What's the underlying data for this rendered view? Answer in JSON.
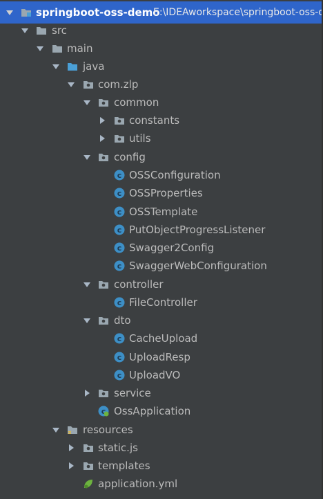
{
  "project_tree": {
    "root": {
      "label": "springboot-oss-demo",
      "path": "E:\\IDEAworkspace\\springboot-oss-demo"
    },
    "nodes": [
      {
        "label": "src"
      },
      {
        "label": "main"
      },
      {
        "label": "java"
      },
      {
        "label": "com.zlp"
      },
      {
        "label": "common"
      },
      {
        "label": "constants"
      },
      {
        "label": "utils"
      },
      {
        "label": "config"
      },
      {
        "label": "OSSConfiguration"
      },
      {
        "label": "OSSProperties"
      },
      {
        "label": "OSSTemplate"
      },
      {
        "label": "PutObjectProgressListener"
      },
      {
        "label": "Swagger2Config"
      },
      {
        "label": "SwaggerWebConfiguration"
      },
      {
        "label": "controller"
      },
      {
        "label": "FileController"
      },
      {
        "label": "dto"
      },
      {
        "label": "CacheUpload"
      },
      {
        "label": "UploadResp"
      },
      {
        "label": "UploadVO"
      },
      {
        "label": "service"
      },
      {
        "label": "OssApplication"
      },
      {
        "label": "resources"
      },
      {
        "label": "static.js"
      },
      {
        "label": "templates"
      },
      {
        "label": "application.yml"
      }
    ]
  },
  "colors": {
    "background": "#3c3f41",
    "selection": "#2f65ca",
    "text": "#bbbbbb",
    "class_icon": "#3d8fc6",
    "folder_icon": "#9aa7b0",
    "source_folder_icon": "#4a9fd6"
  }
}
